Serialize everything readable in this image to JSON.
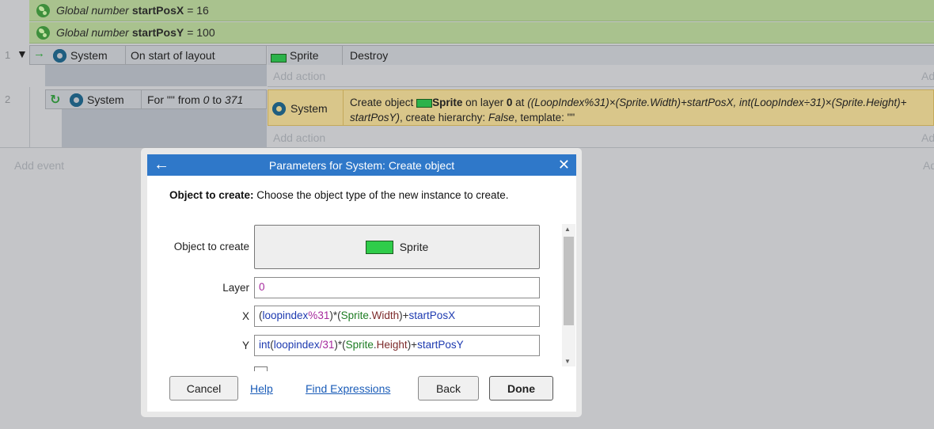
{
  "global_vars": [
    {
      "prefix": "Global number",
      "name": "startPosX",
      "value": "= 16"
    },
    {
      "prefix": "Global number",
      "name": "startPosY",
      "value": "= 100"
    }
  ],
  "events": [
    {
      "number": "1",
      "condition_object": "System",
      "condition_text": "On start of layout",
      "action_object": "Sprite",
      "action_text": "Destroy",
      "add_action": "Add action"
    },
    {
      "number": "2",
      "condition_object": "System",
      "condition_text_prefix": "For",
      "condition_text_quote": "\"\"",
      "condition_text_from": "from",
      "condition_text_start": "0",
      "condition_text_to": "to",
      "condition_text_end": "371",
      "action_object": "System",
      "action_line1_a": "Create object",
      "action_line1_obj": "Sprite",
      "action_line1_b": "on layer",
      "action_line1_layer": "0",
      "action_line1_c": "at",
      "action_line1_expr": "((LoopIndex%31)×(Sprite.Width)+startPosX, int(LoopIndex÷31)×(Sprite.Height)+",
      "action_line2_expr": "startPosY)",
      "action_line2_a": ", create hierarchy:",
      "action_line2_h": "False",
      "action_line2_b": ", template: \"\"",
      "add_action": "Add action"
    }
  ],
  "add_event": "Add event",
  "add_right_1": "Ad",
  "add_right_2": "Ad",
  "add_right_3": "Ad",
  "dialog": {
    "title": "Parameters for System: Create object",
    "description_label": "Object to create:",
    "description_text": "Choose the object type of the new instance to create.",
    "params": {
      "object_label": "Object to create",
      "object_value": "Sprite",
      "layer_label": "Layer",
      "layer_value": "0",
      "x_label": "X",
      "y_label": "Y"
    },
    "x_expr": {
      "p1": "(",
      "p2": "loopindex",
      "p3": "%",
      "p4": "31",
      "p5": ")*(",
      "p6": "Sprite",
      "p7": ".",
      "p8": "Width",
      "p9": ")+",
      "p10": "startPosX"
    },
    "y_expr": {
      "p1": "int",
      "p2": "(",
      "p3": "loopindex",
      "p4": "/",
      "p5": "31",
      "p6": ")*(",
      "p7": "Sprite",
      "p8": ".",
      "p9": "Height",
      "p10": ")+",
      "p11": "startPosY"
    },
    "buttons": {
      "cancel": "Cancel",
      "help": "Help",
      "find_expressions": "Find Expressions",
      "back": "Back",
      "done": "Done"
    }
  },
  "colors": {
    "accent": "#2f78c9",
    "global_bar": "#a9c28e",
    "sprite_green": "#2fcc4a",
    "selected_action": "#d9c68a"
  }
}
